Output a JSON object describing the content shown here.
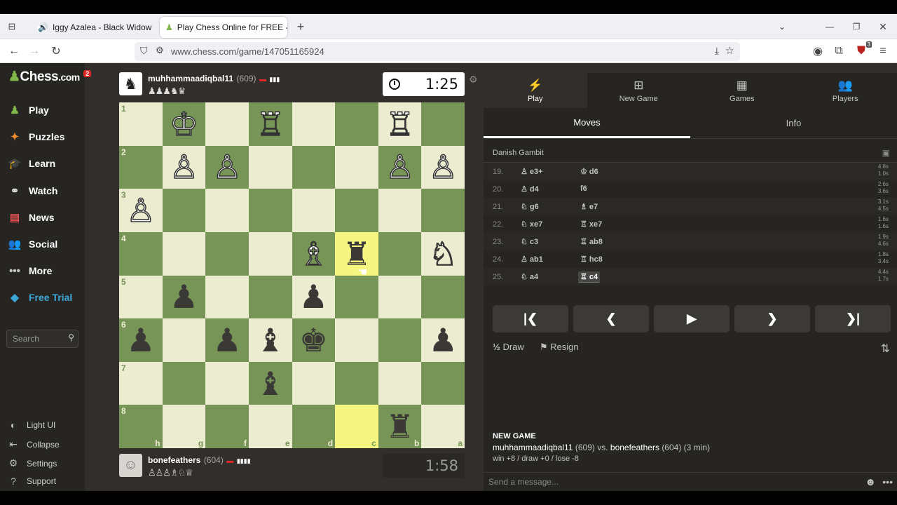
{
  "browser": {
    "tabs": [
      {
        "label": "Iggy Azalea - Black Widow",
        "active": false
      },
      {
        "label": "Play Chess Online for FREE - 2 P",
        "active": true
      }
    ],
    "url": "www.chess.com/game/147051165924",
    "downloads_badge": "3"
  },
  "sidebar": {
    "logo": "Chess",
    "logo_suffix": ".com",
    "notification_count": "2",
    "items": [
      {
        "label": "Play",
        "icon": "pawn-icon"
      },
      {
        "label": "Puzzles",
        "icon": "puzzle-icon"
      },
      {
        "label": "Learn",
        "icon": "graduation-icon"
      },
      {
        "label": "Watch",
        "icon": "binoculars-icon"
      },
      {
        "label": "News",
        "icon": "newspaper-icon"
      },
      {
        "label": "Social",
        "icon": "people-icon"
      },
      {
        "label": "More",
        "icon": "dots-icon"
      },
      {
        "label": "Free Trial",
        "icon": "diamond-icon"
      }
    ],
    "search_placeholder": "Search",
    "bottom": [
      {
        "label": "Light UI",
        "icon": "contrast-icon"
      },
      {
        "label": "Collapse",
        "icon": "collapse-icon"
      },
      {
        "label": "Settings",
        "icon": "gear-icon"
      },
      {
        "label": "Support",
        "icon": "help-icon"
      }
    ]
  },
  "top_player": {
    "name": "muhhammaadiqbal11",
    "rating": "(609)",
    "captured": "♟♟♟♞♛",
    "clock": "1:25"
  },
  "bottom_player": {
    "name": "bonefeathers",
    "rating": "(604)",
    "captured": "♙♙♙♗♘♕",
    "clock": "1:58"
  },
  "board": {
    "ranks": [
      "1",
      "2",
      "3",
      "4",
      "5",
      "6",
      "7",
      "8"
    ],
    "files": [
      "h",
      "g",
      "f",
      "e",
      "d",
      "c",
      "b",
      "a"
    ],
    "pieces": [
      [
        "",
        "♔w",
        "",
        "♖w",
        "",
        "",
        "♖w",
        ""
      ],
      [
        "",
        "♙w",
        "♙w",
        "",
        "",
        "",
        "♙w",
        "♙w"
      ],
      [
        "♙w",
        "",
        "",
        "",
        "",
        "",
        "",
        ""
      ],
      [
        "",
        "",
        "",
        "",
        "♗w",
        "♜b",
        "",
        "♘w"
      ],
      [
        "",
        "♟b",
        "",
        "",
        "♟b",
        "",
        "",
        ""
      ],
      [
        "♟b",
        "",
        "♟b",
        "♝b",
        "♚b",
        "",
        "",
        "♟b"
      ],
      [
        "",
        "",
        "",
        "♝b",
        "",
        "",
        "",
        ""
      ],
      [
        "",
        "",
        "",
        "",
        "",
        "",
        "♜b",
        ""
      ]
    ],
    "highlight_from": [
      7,
      5
    ],
    "highlight_to": [
      3,
      5
    ]
  },
  "panel": {
    "tabs": [
      {
        "label": "Play",
        "icon": "lightning-icon"
      },
      {
        "label": "New Game",
        "icon": "plus-icon"
      },
      {
        "label": "Games",
        "icon": "board-icon"
      },
      {
        "label": "Players",
        "icon": "players-icon"
      }
    ],
    "subtabs": [
      "Moves",
      "Info"
    ],
    "opening": "Danish Gambit",
    "moves": [
      {
        "num": "19.",
        "w": "e3+",
        "wp": "♙",
        "b": "d6",
        "bp": "♔",
        "tw": "4.8s",
        "tb": "1.0s"
      },
      {
        "num": "20.",
        "w": "d4",
        "wp": "♙",
        "b": "f6",
        "bp": "",
        "tw": "2.6s",
        "tb": "3.6s"
      },
      {
        "num": "21.",
        "w": "g6",
        "wp": "♘",
        "b": "e7",
        "bp": "♗",
        "tw": "3.1s",
        "tb": "4.5s"
      },
      {
        "num": "22.",
        "w": "xe7",
        "wp": "♘",
        "b": "xe7",
        "bp": "♖",
        "tw": "1.6s",
        "tb": "1.6s"
      },
      {
        "num": "23.",
        "w": "c3",
        "wp": "♘",
        "b": "ab8",
        "bp": "♖",
        "tw": "1.9s",
        "tb": "4.6s"
      },
      {
        "num": "24.",
        "w": "ab1",
        "wp": "♙",
        "b": "hc8",
        "bp": "♖",
        "tw": "1.8s",
        "tb": "3.4s"
      },
      {
        "num": "25.",
        "w": "a4",
        "wp": "♘",
        "b": "c4",
        "bp": "♖",
        "tw": "4.4s",
        "tb": "1.7s"
      }
    ],
    "draw_label": "Draw",
    "draw_icon": "½",
    "resign_label": "Resign",
    "new_game": {
      "heading": "NEW GAME",
      "p1": "muhhammaadiqbal11",
      "p1_rating": "(609)",
      "vs": "vs.",
      "p2": "bonefeathers",
      "p2_rating": "(604)",
      "time": "(3 min)",
      "result": "win +8 / draw +0 / lose -8"
    },
    "message_placeholder": "Send a message..."
  },
  "colors": {
    "light_square": "#ebecd0",
    "dark_square": "#779556",
    "highlight": "#f5f682",
    "background": "#312e2b"
  }
}
